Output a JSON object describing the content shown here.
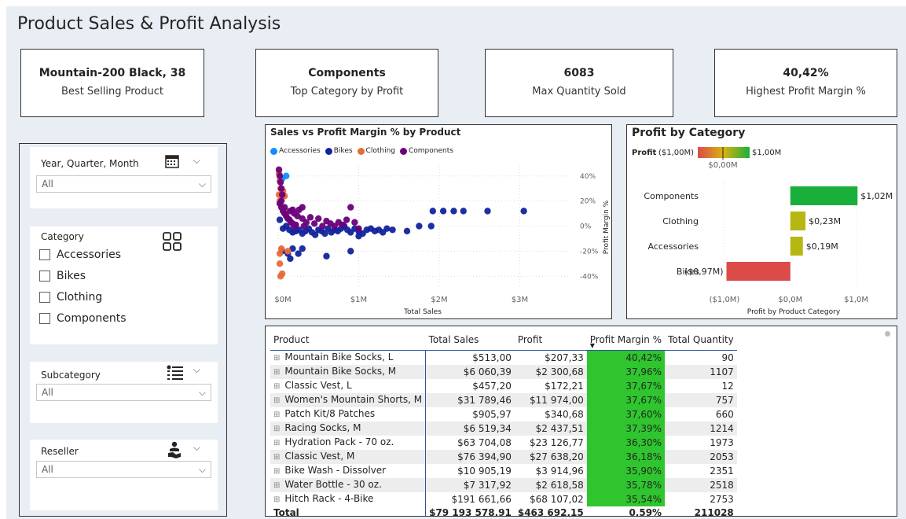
{
  "page": {
    "title": "Product Sales & Profit Analysis"
  },
  "kpis": [
    {
      "value": "Mountain-200 Black, 38",
      "label": "Best Selling Product"
    },
    {
      "value": "Components",
      "label": "Top Category by Profit"
    },
    {
      "value": "6083",
      "label": "Max Quantity Sold"
    },
    {
      "value": "40,42%",
      "label": "Highest Profit Margin %"
    }
  ],
  "slicers": {
    "date": {
      "label": "Year, Quarter, Month",
      "value": "All",
      "icon": "calendar-icon"
    },
    "category": {
      "label": "Category",
      "icon": "grid-icon",
      "options": [
        "Accessories",
        "Bikes",
        "Clothing",
        "Components"
      ]
    },
    "subcategory": {
      "label": "Subcategory",
      "value": "All",
      "icon": "list-icon"
    },
    "reseller": {
      "label": "Reseller",
      "value": "All",
      "icon": "handshake-icon"
    },
    "chevron": "⌵"
  },
  "chart_data": [
    {
      "type": "scatter",
      "title": "Sales vs Profit Margin % by Product",
      "xlabel": "Total Sales",
      "ylabel": "Profit Margin %",
      "x_ticks": [
        "$0M",
        "$1M",
        "$2M",
        "$3M"
      ],
      "y_ticks": [
        "40%",
        "20%",
        "0%",
        "-20%",
        "-40%"
      ],
      "xlim": [
        0,
        3.6
      ],
      "ylim": [
        -48,
        48
      ],
      "legend": "top-left",
      "series": [
        {
          "name": "Accessories",
          "color": "#118dff",
          "points": [
            [
              0.1,
              40
            ],
            [
              0.05,
              38
            ]
          ]
        },
        {
          "name": "Bikes",
          "color": "#12239e",
          "points": [
            [
              0.02,
              5
            ],
            [
              0.06,
              -2
            ],
            [
              0.1,
              0
            ],
            [
              0.14,
              -3
            ],
            [
              0.18,
              -5
            ],
            [
              0.22,
              -4
            ],
            [
              0.26,
              -3
            ],
            [
              0.3,
              -6
            ],
            [
              0.34,
              -4
            ],
            [
              0.38,
              -2
            ],
            [
              0.42,
              -5
            ],
            [
              0.46,
              -7
            ],
            [
              0.5,
              -3
            ],
            [
              0.54,
              -4
            ],
            [
              0.58,
              -6
            ],
            [
              0.62,
              -2
            ],
            [
              0.66,
              -5
            ],
            [
              0.7,
              -3
            ],
            [
              0.74,
              -4
            ],
            [
              0.78,
              -2
            ],
            [
              0.82,
              0
            ],
            [
              0.86,
              -3
            ],
            [
              0.9,
              -5
            ],
            [
              0.95,
              -2
            ],
            [
              1.0,
              -4
            ],
            [
              1.05,
              -6
            ],
            [
              1.1,
              -3
            ],
            [
              1.15,
              -2
            ],
            [
              1.2,
              -4
            ],
            [
              1.25,
              -3
            ],
            [
              1.3,
              -5
            ],
            [
              1.35,
              -2
            ],
            [
              1.42,
              -3
            ],
            [
              1.6,
              -4
            ],
            [
              1.75,
              0
            ],
            [
              1.9,
              0
            ],
            [
              1.92,
              12
            ],
            [
              2.05,
              12
            ],
            [
              2.18,
              12
            ],
            [
              2.3,
              12
            ],
            [
              2.6,
              12
            ],
            [
              3.05,
              12
            ],
            [
              0.05,
              -20
            ],
            [
              0.12,
              -22
            ],
            [
              0.18,
              -18
            ],
            [
              0.25,
              -22
            ],
            [
              0.3,
              -18
            ],
            [
              0.6,
              -24
            ],
            [
              0.9,
              -20
            ],
            [
              0.15,
              -26
            ],
            [
              1.0,
              -8
            ]
          ]
        },
        {
          "name": "Clothing",
          "color": "#e66c37",
          "points": [
            [
              0.01,
              42
            ],
            [
              0.02,
              36
            ],
            [
              0.03,
              30
            ],
            [
              0.01,
              25
            ],
            [
              0.02,
              20
            ],
            [
              0.04,
              -18
            ],
            [
              0.02,
              -22
            ],
            [
              0.03,
              -40
            ],
            [
              0.05,
              -38
            ],
            [
              0.02,
              -30
            ],
            [
              0.06,
              28
            ],
            [
              0.08,
              24
            ],
            [
              0.1,
              12
            ],
            [
              0.12,
              -20
            ]
          ]
        },
        {
          "name": "Components",
          "color": "#6b007b",
          "points": [
            [
              0.01,
              45
            ],
            [
              0.02,
              40
            ],
            [
              0.03,
              35
            ],
            [
              0.04,
              30
            ],
            [
              0.05,
              25
            ],
            [
              0.02,
              18
            ],
            [
              0.04,
              15
            ],
            [
              0.06,
              12
            ],
            [
              0.08,
              10
            ],
            [
              0.1,
              8
            ],
            [
              0.12,
              6
            ],
            [
              0.14,
              5
            ],
            [
              0.16,
              3
            ],
            [
              0.18,
              2
            ],
            [
              0.2,
              0
            ],
            [
              0.22,
              1
            ],
            [
              0.24,
              8
            ],
            [
              0.26,
              13
            ],
            [
              0.3,
              6
            ],
            [
              0.32,
              0
            ],
            [
              0.35,
              3
            ],
            [
              0.4,
              7
            ],
            [
              0.45,
              2
            ],
            [
              0.5,
              6
            ],
            [
              0.55,
              0
            ],
            [
              0.6,
              4
            ],
            [
              0.65,
              2
            ],
            [
              0.7,
              0
            ],
            [
              0.75,
              3
            ],
            [
              0.8,
              1
            ],
            [
              0.85,
              5
            ],
            [
              0.9,
              15
            ],
            [
              0.95,
              3
            ],
            [
              1.0,
              -2
            ],
            [
              0.3,
              15
            ],
            [
              0.18,
              13
            ],
            [
              0.08,
              15
            ],
            [
              0.04,
              20
            ],
            [
              0.2,
              10
            ],
            [
              0.15,
              12
            ]
          ]
        }
      ]
    },
    {
      "type": "bar",
      "orientation": "horizontal",
      "title": "Profit by Category",
      "xlabel": "Profit by Product Category",
      "legend_title": "Profit",
      "legend_min": "($1,00M)",
      "legend_max": "$1,00M",
      "legend_mid": "$0,00M",
      "categories": [
        "Components",
        "Clothing",
        "Accessories",
        "Bikes"
      ],
      "values": [
        1.02,
        0.23,
        0.19,
        -0.97
      ],
      "value_labels": [
        "$1,02M",
        "$0,23M",
        "$0,19M",
        "($0,97M)"
      ],
      "colors": [
        "#1aaf3a",
        "#b5b812",
        "#b5b812",
        "#dc4a4a"
      ],
      "x_ticks": [
        "($1,0M)",
        "$0,0M",
        "$1,0M"
      ],
      "xlim": [
        -1.0,
        1.1
      ]
    }
  ],
  "matrix": {
    "columns": [
      "Product",
      "Total Sales",
      "Profit",
      "Profit Margin %",
      "Total Quantity"
    ],
    "rows": [
      [
        "Mountain Bike Socks, L",
        "$513,00",
        "$207,33",
        "40,42%",
        "90"
      ],
      [
        "Mountain Bike Socks, M",
        "$6 060,39",
        "$2 300,68",
        "37,96%",
        "1107"
      ],
      [
        "Classic Vest, L",
        "$457,20",
        "$172,21",
        "37,67%",
        "12"
      ],
      [
        "Women's Mountain Shorts, M",
        "$31 789,46",
        "$11 974,00",
        "37,67%",
        "757"
      ],
      [
        "Patch Kit/8 Patches",
        "$905,97",
        "$340,68",
        "37,60%",
        "660"
      ],
      [
        "Racing Socks, M",
        "$6 519,34",
        "$2 437,51",
        "37,39%",
        "1214"
      ],
      [
        "Hydration Pack - 70 oz.",
        "$63 704,08",
        "$23 126,77",
        "36,30%",
        "1973"
      ],
      [
        "Classic Vest, M",
        "$76 394,90",
        "$27 638,20",
        "36,18%",
        "2053"
      ],
      [
        "Bike Wash - Dissolver",
        "$10 905,19",
        "$3 914,96",
        "35,90%",
        "2351"
      ],
      [
        "Water Bottle - 30 oz.",
        "$7 317,92",
        "$2 618,58",
        "35,78%",
        "2518"
      ],
      [
        "Hitch Rack - 4-Bike",
        "$191 661,66",
        "$68 107,02",
        "35,54%",
        "2753"
      ]
    ],
    "total": [
      "Total",
      "$79 193 578,91",
      "$463 692,15",
      "0,59%",
      "211028"
    ],
    "sort_indicator": "▼",
    "expand_glyph": "⊞"
  }
}
